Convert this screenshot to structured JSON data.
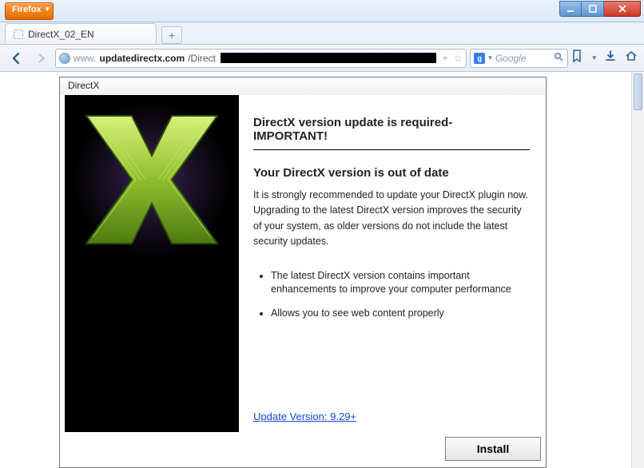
{
  "window": {
    "app_label": "Firefox",
    "buttons": {
      "minimize": "–",
      "maximize": "☐",
      "close": "✕"
    }
  },
  "tabs": {
    "active": {
      "title": "DirectX_02_EN"
    },
    "newtab_label": "+"
  },
  "urlbar": {
    "prefix": "www.",
    "domain": "updatedirectx.com",
    "path": "/Direct",
    "star_tip": "☆",
    "dropdown_tip": "▾",
    "search_provider_glyph": "g",
    "search_dropdown": "▾",
    "search_placeholder": "Google",
    "bookmark_dropdown": "▾"
  },
  "dialog": {
    "title": "DirectX",
    "heading": "DirectX version update is required- IMPORTANT!",
    "subheading": "Your DirectX version is out of date",
    "paragraph": "It is strongly recommended to update your DirectX plugin now. Upgrading to the latest DirectX version improves the security of your system, as older versions do not include the latest security updates.",
    "bullets": [
      "The latest DirectX version contains important enhancements to improve your computer performance",
      "Allows you to see web content properly"
    ],
    "update_link": "Update Version: 9.29+",
    "install_label": "Install"
  }
}
